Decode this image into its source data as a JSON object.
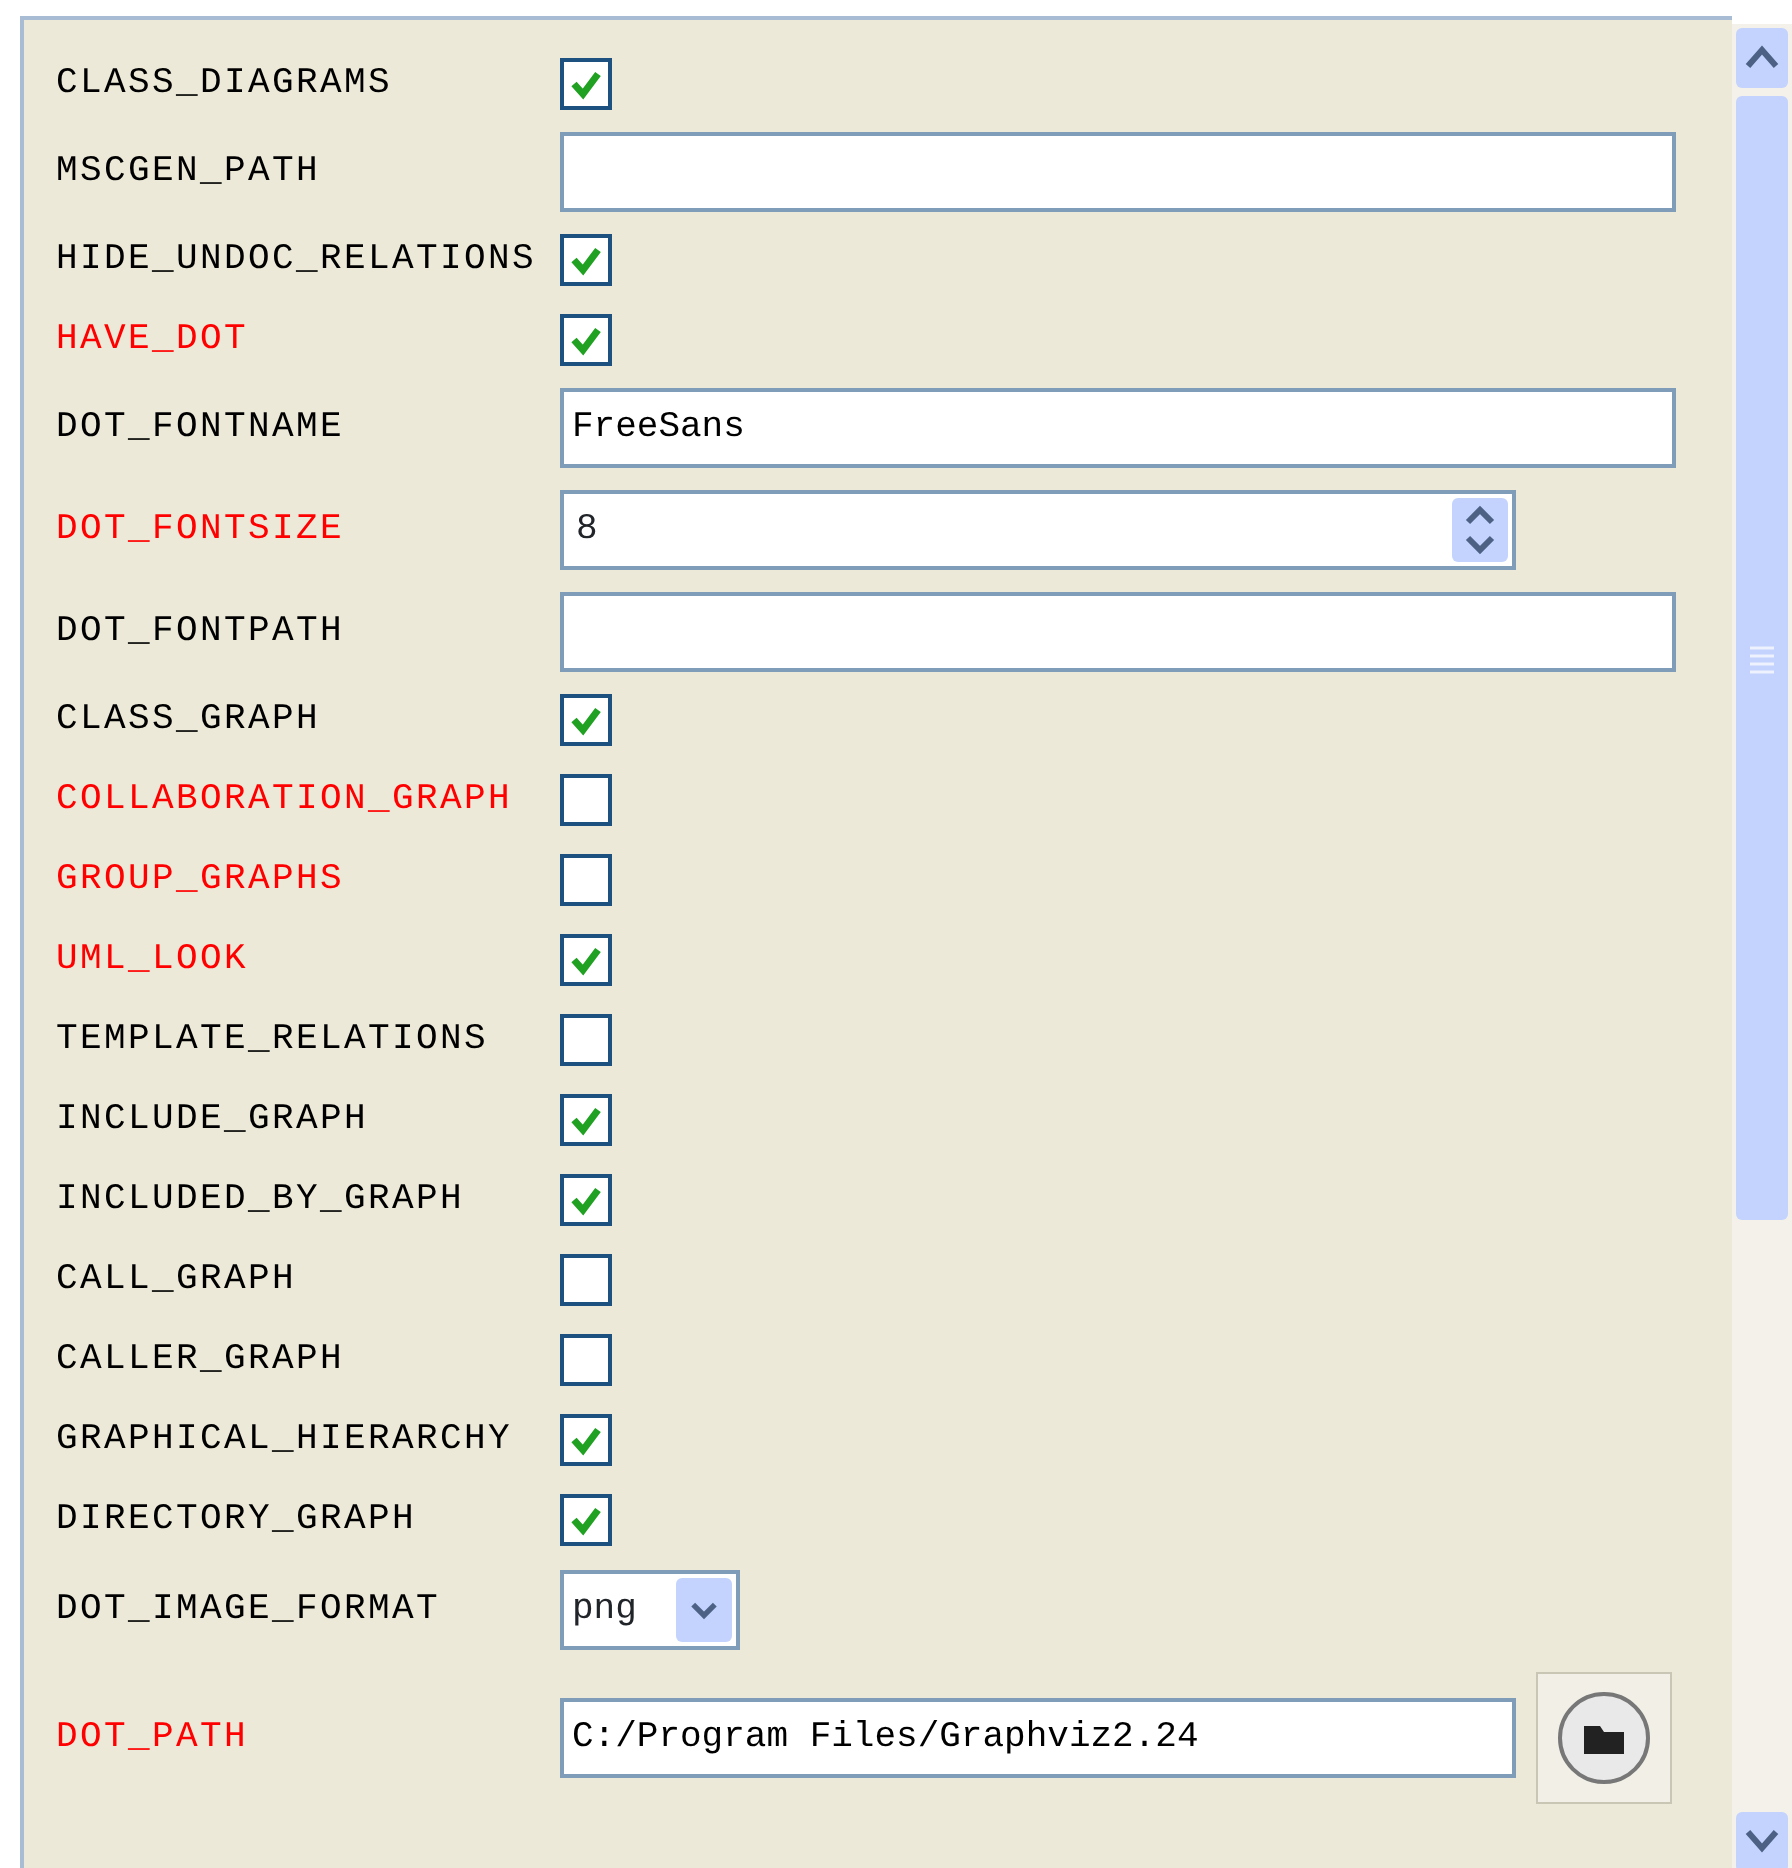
{
  "options": [
    {
      "label": "CLASS_DIAGRAMS",
      "modified": false,
      "kind": "checkbox",
      "checked": true
    },
    {
      "label": "MSCGEN_PATH",
      "modified": false,
      "kind": "text"
    },
    {
      "label": "HIDE_UNDOC_RELATIONS",
      "modified": false,
      "kind": "checkbox",
      "checked": true
    },
    {
      "label": "HAVE_DOT",
      "modified": true,
      "kind": "checkbox",
      "checked": true
    },
    {
      "label": "DOT_FONTNAME",
      "modified": false,
      "kind": "text",
      "value": "FreeSans"
    },
    {
      "label": "DOT_FONTSIZE",
      "modified": true,
      "kind": "spin",
      "value": "8"
    },
    {
      "label": "DOT_FONTPATH",
      "modified": false,
      "kind": "text"
    },
    {
      "label": "CLASS_GRAPH",
      "modified": false,
      "kind": "checkbox",
      "checked": true
    },
    {
      "label": "COLLABORATION_GRAPH",
      "modified": true,
      "kind": "checkbox",
      "checked": false
    },
    {
      "label": "GROUP_GRAPHS",
      "modified": true,
      "kind": "checkbox",
      "checked": false
    },
    {
      "label": "UML_LOOK",
      "modified": true,
      "kind": "checkbox",
      "checked": true
    },
    {
      "label": "TEMPLATE_RELATIONS",
      "modified": false,
      "kind": "checkbox",
      "checked": false
    },
    {
      "label": "INCLUDE_GRAPH",
      "modified": false,
      "kind": "checkbox",
      "checked": true
    },
    {
      "label": "INCLUDED_BY_GRAPH",
      "modified": false,
      "kind": "checkbox",
      "checked": true
    },
    {
      "label": "CALL_GRAPH",
      "modified": false,
      "kind": "checkbox",
      "checked": false
    },
    {
      "label": "CALLER_GRAPH",
      "modified": false,
      "kind": "checkbox",
      "checked": false
    },
    {
      "label": "GRAPHICAL_HIERARCHY",
      "modified": false,
      "kind": "checkbox",
      "checked": true
    },
    {
      "label": "DIRECTORY_GRAPH",
      "modified": false,
      "kind": "checkbox",
      "checked": true
    },
    {
      "label": "DOT_IMAGE_FORMAT",
      "modified": false,
      "kind": "combo",
      "value": "png"
    },
    {
      "label": "DOT_PATH",
      "modified": true,
      "kind": "path",
      "value": "C:/Program Files/Graphviz2.24"
    }
  ]
}
